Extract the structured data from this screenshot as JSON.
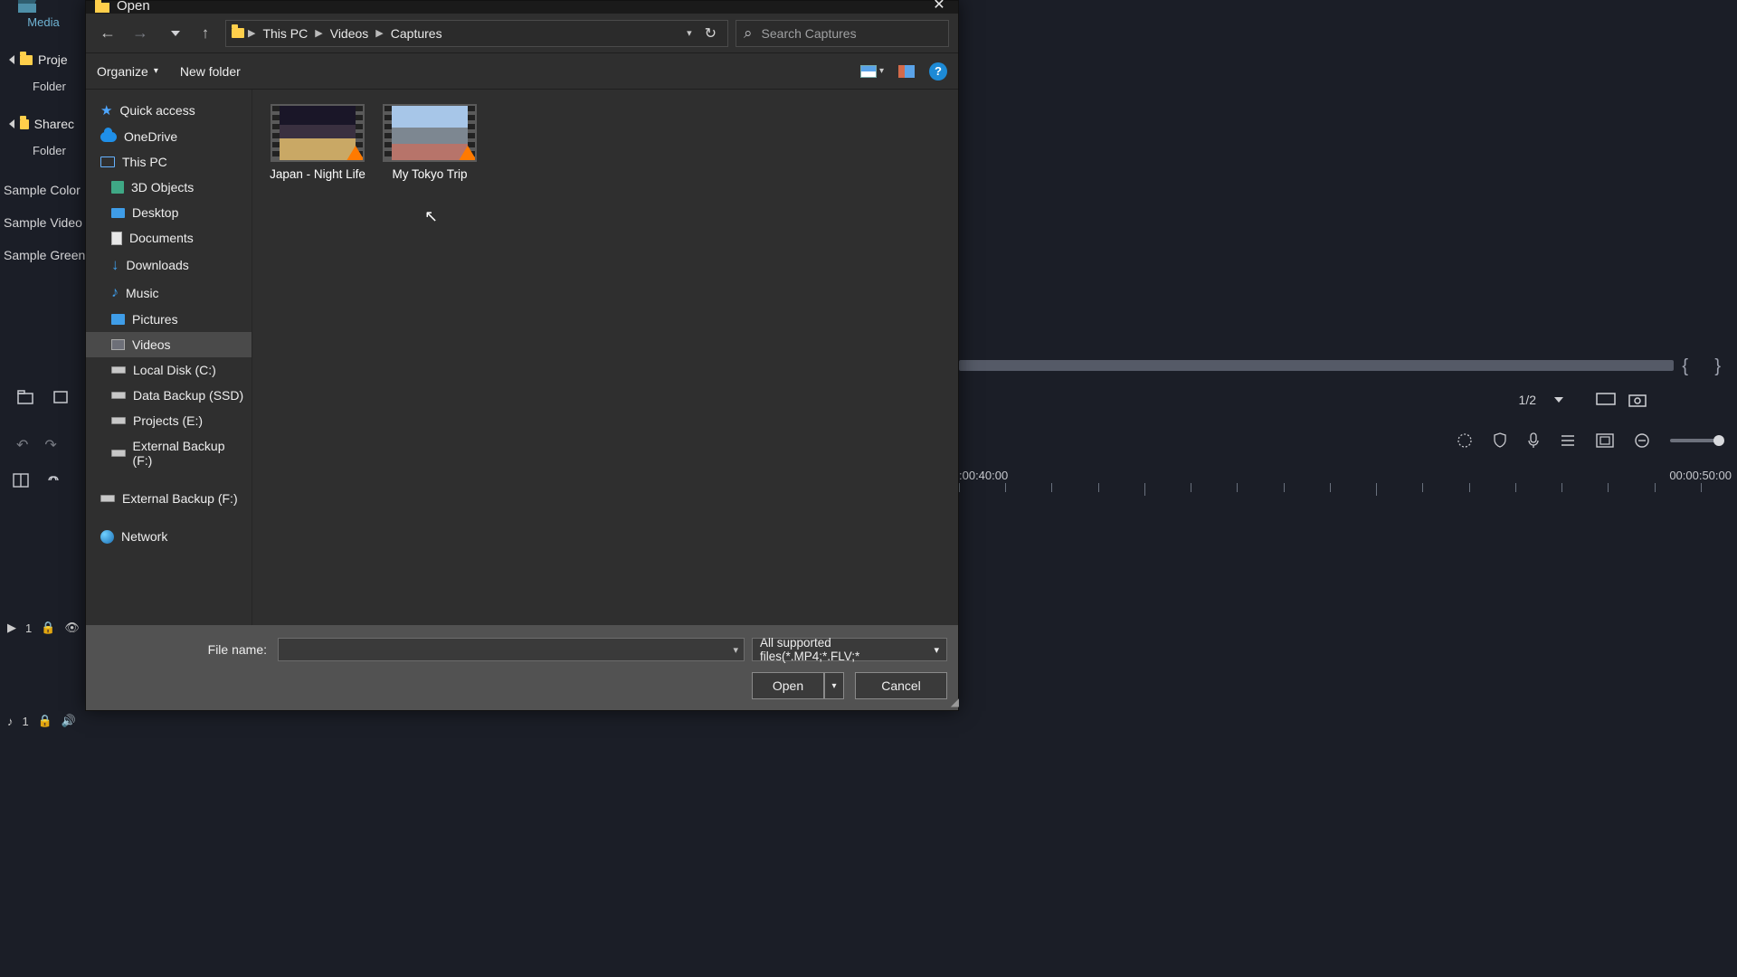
{
  "app": {
    "media_tab": "Media",
    "left_tree": [
      {
        "label": "Proje",
        "sub": "Folder"
      },
      {
        "label": "Sharec",
        "sub": "Folder"
      }
    ],
    "samples": [
      "Sample Color",
      "Sample Video",
      "Sample Green"
    ],
    "pager": "1/2",
    "timecodes": [
      ":00:40:00",
      "00:00:50:00"
    ],
    "track_v": "1",
    "track_a": "1"
  },
  "dialog": {
    "title": "Open",
    "nav": {
      "back": "back",
      "forward": "forward",
      "recent": "recent-locations",
      "up": "up"
    },
    "breadcrumb": [
      "This PC",
      "Videos",
      "Captures"
    ],
    "search_placeholder": "Search Captures",
    "toolbar": {
      "organize": "Organize",
      "new_folder": "New folder"
    },
    "tree": {
      "quick_access": "Quick access",
      "onedrive": "OneDrive",
      "this_pc": "This PC",
      "children": [
        "3D Objects",
        "Desktop",
        "Documents",
        "Downloads",
        "Music",
        "Pictures",
        "Videos",
        "Local Disk (C:)",
        "Data Backup (SSD)",
        "Projects (E:)",
        "External Backup (F:)"
      ],
      "extra": "External Backup (F:)",
      "network": "Network",
      "selected": "Videos"
    },
    "files": [
      {
        "name": "Japan - Night Life"
      },
      {
        "name": "My Tokyo Trip"
      }
    ],
    "footer": {
      "file_name_label": "File name:",
      "file_name_value": "",
      "type_filter": "All supported files(*.MP4;*.FLV;*",
      "open": "Open",
      "cancel": "Cancel"
    }
  }
}
